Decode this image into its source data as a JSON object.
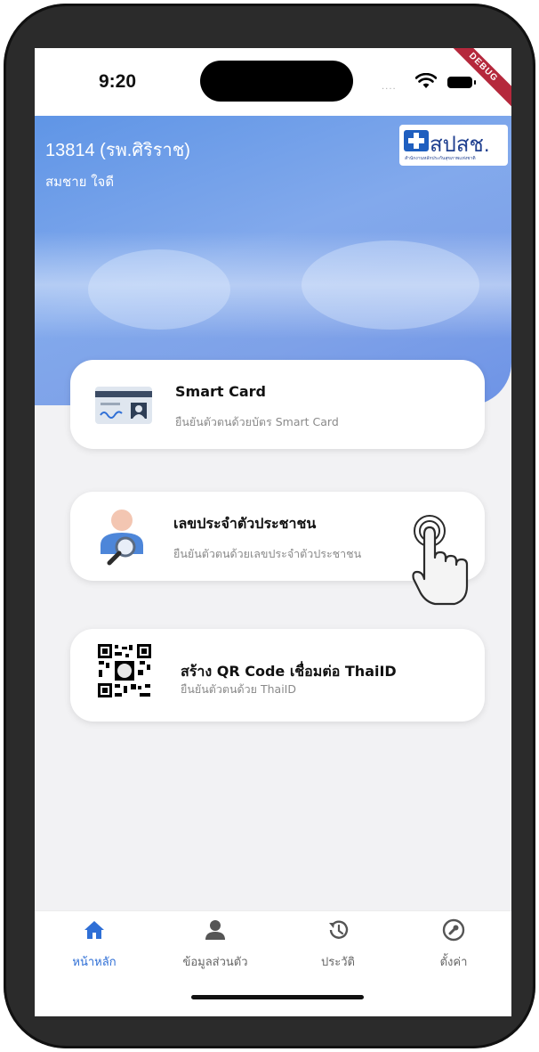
{
  "status": {
    "time": "9:20",
    "signal": "....",
    "debug_banner": "DEBUG"
  },
  "header": {
    "hospital": "13814 (รพ.ศิริราช)",
    "user_name": "สมชาย ใจดี",
    "logo_text": "สปสช.",
    "logo_subtext": "สำนักงานหลักประกันสุขภาพแห่งชาติ"
  },
  "options": [
    {
      "title": "Smart Card",
      "subtitle": "ยืนยันตัวตนด้วยบัตร Smart Card",
      "icon": "id-card-icon"
    },
    {
      "title": "เลขประจำตัวประชาชน",
      "subtitle": "ยืนยันตัวตนด้วยเลขประจำตัวประชาชน",
      "icon": "person-search-icon"
    },
    {
      "title": "สร้าง QR Code เชื่อมต่อ ThaiID",
      "subtitle": "ยืนยันตัวตนด้วย ThaiID",
      "icon": "qr-code-icon"
    }
  ],
  "nav": [
    {
      "label": "หน้าหลัก",
      "icon": "home-icon",
      "active": true
    },
    {
      "label": "ข้อมูลส่วนตัว",
      "icon": "person-icon",
      "active": false
    },
    {
      "label": "ประวัติ",
      "icon": "history-icon",
      "active": false
    },
    {
      "label": "ตั้งค่า",
      "icon": "wrench-icon",
      "active": false
    }
  ],
  "colors": {
    "accent": "#2f6fd6",
    "header": "#6f9ae8",
    "debug": "#b5283c"
  }
}
